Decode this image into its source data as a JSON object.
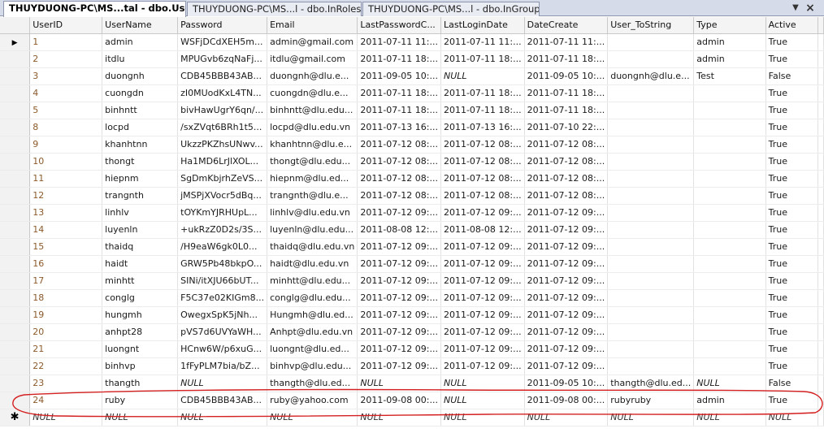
{
  "tabs": [
    {
      "label": "THUYDUONG-PC\\MS...tal - dbo.Users",
      "active": true
    },
    {
      "label": "THUYDUONG-PC\\MS...l - dbo.InRoles",
      "active": false
    },
    {
      "label": "THUYDUONG-PC\\MS...l - dbo.InGroup",
      "active": false
    }
  ],
  "tab_controls": {
    "dropdown": "▼",
    "close": "×"
  },
  "columns": [
    "UserID",
    "UserName",
    "Password",
    "Email",
    "LastPasswordC...",
    "LastLoginDate",
    "DateCreate",
    "User_ToString",
    "Type",
    "Active"
  ],
  "rows": [
    [
      "1",
      "admin",
      "WSFjDCdXEH5m...",
      "admin@gmail.com",
      "2011-07-11 11:...",
      "2011-07-11 11:...",
      "2011-07-11 11:...",
      "",
      "admin",
      "True"
    ],
    [
      "2",
      "itdlu",
      "MPUGvb6zqNaFj...",
      "itdlu@gmail.com",
      "2011-07-11 18:...",
      "2011-07-11 18:...",
      "2011-07-11 18:...",
      "",
      "admin",
      "True"
    ],
    [
      "3",
      "duongnh",
      "CDB45BBB43AB...",
      "duongnh@dlu.e...",
      "2011-09-05 10:...",
      "NULL",
      "2011-09-05 10:...",
      "duongnh@dlu.e...",
      "Test",
      "False"
    ],
    [
      "4",
      "cuongdn",
      "zI0MUodKxL4TN...",
      "cuongdn@dlu.e...",
      "2011-07-11 18:...",
      "2011-07-11 18:...",
      "2011-07-11 18:...",
      "",
      "",
      "True"
    ],
    [
      "5",
      "binhntt",
      "bivHawUgrY6qn/...",
      "binhntt@dlu.edu...",
      "2011-07-11 18:...",
      "2011-07-11 18:...",
      "2011-07-11 18:...",
      "",
      "",
      "True"
    ],
    [
      "8",
      "locpd",
      "/sxZVqt6BRh1t5...",
      "locpd@dlu.edu.vn",
      "2011-07-13 16:...",
      "2011-07-13 16:...",
      "2011-07-10 22:...",
      "",
      "",
      "True"
    ],
    [
      "9",
      "khanhtnn",
      "UkzzPKZhsUNwv...",
      "khanhtnn@dlu.e...",
      "2011-07-12 08:...",
      "2011-07-12 08:...",
      "2011-07-12 08:...",
      "",
      "",
      "True"
    ],
    [
      "10",
      "thongt",
      "Ha1MD6LrJlXOL...",
      "thongt@dlu.edu...",
      "2011-07-12 08:...",
      "2011-07-12 08:...",
      "2011-07-12 08:...",
      "",
      "",
      "True"
    ],
    [
      "11",
      "hiepnm",
      "SgDmKbjrhZeVS...",
      "hiepnm@dlu.ed...",
      "2011-07-12 08:...",
      "2011-07-12 08:...",
      "2011-07-12 08:...",
      "",
      "",
      "True"
    ],
    [
      "12",
      "trangnth",
      "jMSPjXVocr5dBq...",
      "trangnth@dlu.e...",
      "2011-07-12 08:...",
      "2011-07-12 08:...",
      "2011-07-12 08:...",
      "",
      "",
      "True"
    ],
    [
      "13",
      "linhlv",
      "tOYKmYJRHUpL...",
      "linhlv@dlu.edu.vn",
      "2011-07-12 09:...",
      "2011-07-12 09:...",
      "2011-07-12 09:...",
      "",
      "",
      "True"
    ],
    [
      "14",
      "luyenln",
      "+ukRzZ0D2s/3S...",
      "luyenln@dlu.edu...",
      "2011-08-08 12:...",
      "2011-08-08 12:...",
      "2011-07-12 09:...",
      "",
      "",
      "True"
    ],
    [
      "15",
      "thaidq",
      "/H9eaW6gk0L0...",
      "thaidq@dlu.edu.vn",
      "2011-07-12 09:...",
      "2011-07-12 09:...",
      "2011-07-12 09:...",
      "",
      "",
      "True"
    ],
    [
      "16",
      "haidt",
      "GRW5Pb48bkpO...",
      "haidt@dlu.edu.vn",
      "2011-07-12 09:...",
      "2011-07-12 09:...",
      "2011-07-12 09:...",
      "",
      "",
      "True"
    ],
    [
      "17",
      "minhtt",
      "SINi/itXJU66bUT...",
      "minhtt@dlu.edu...",
      "2011-07-12 09:...",
      "2011-07-12 09:...",
      "2011-07-12 09:...",
      "",
      "",
      "True"
    ],
    [
      "18",
      "conglg",
      "F5C37e02KIGm8...",
      "conglg@dlu.edu...",
      "2011-07-12 09:...",
      "2011-07-12 09:...",
      "2011-07-12 09:...",
      "",
      "",
      "True"
    ],
    [
      "19",
      "hungmh",
      "OwegxSpK5jNh...",
      "Hungmh@dlu.ed...",
      "2011-07-12 09:...",
      "2011-07-12 09:...",
      "2011-07-12 09:...",
      "",
      "",
      "True"
    ],
    [
      "20",
      "anhpt28",
      "pVS7d6UVYaWH...",
      "Anhpt@dlu.edu.vn",
      "2011-07-12 09:...",
      "2011-07-12 09:...",
      "2011-07-12 09:...",
      "",
      "",
      "True"
    ],
    [
      "21",
      "luongnt",
      "HCnw6W/p6xuG...",
      "luongnt@dlu.ed...",
      "2011-07-12 09:...",
      "2011-07-12 09:...",
      "2011-07-12 09:...",
      "",
      "",
      "True"
    ],
    [
      "22",
      "binhvp",
      "1fFyPLM7bia/bZ...",
      "binhvp@dlu.edu...",
      "2011-07-12 09:...",
      "2011-07-12 09:...",
      "2011-07-12 09:...",
      "",
      "",
      "True"
    ],
    [
      "23",
      "thangth",
      "NULL",
      "thangth@dlu.ed...",
      "NULL",
      "NULL",
      "2011-09-05 10:...",
      "thangth@dlu.ed...",
      "NULL",
      "False"
    ],
    [
      "24",
      "ruby",
      "CDB45BBB43AB...",
      "ruby@yahoo.com",
      "2011-09-08 00:...",
      "NULL",
      "2011-09-08 00:...",
      "rubyruby",
      "admin",
      "True"
    ]
  ],
  "new_row": [
    "NULL",
    "NULL",
    "NULL",
    "NULL",
    "NULL",
    "NULL",
    "NULL",
    "NULL",
    "NULL",
    "NULL"
  ],
  "current_row_index": 0,
  "indicators": {
    "current": "▶",
    "new": "✱"
  },
  "colors": {
    "id_text": "#8b5a2b",
    "annotation": "#d42020",
    "tab_active": "#ffffff",
    "tab_inactive": "#e9ecf3"
  }
}
